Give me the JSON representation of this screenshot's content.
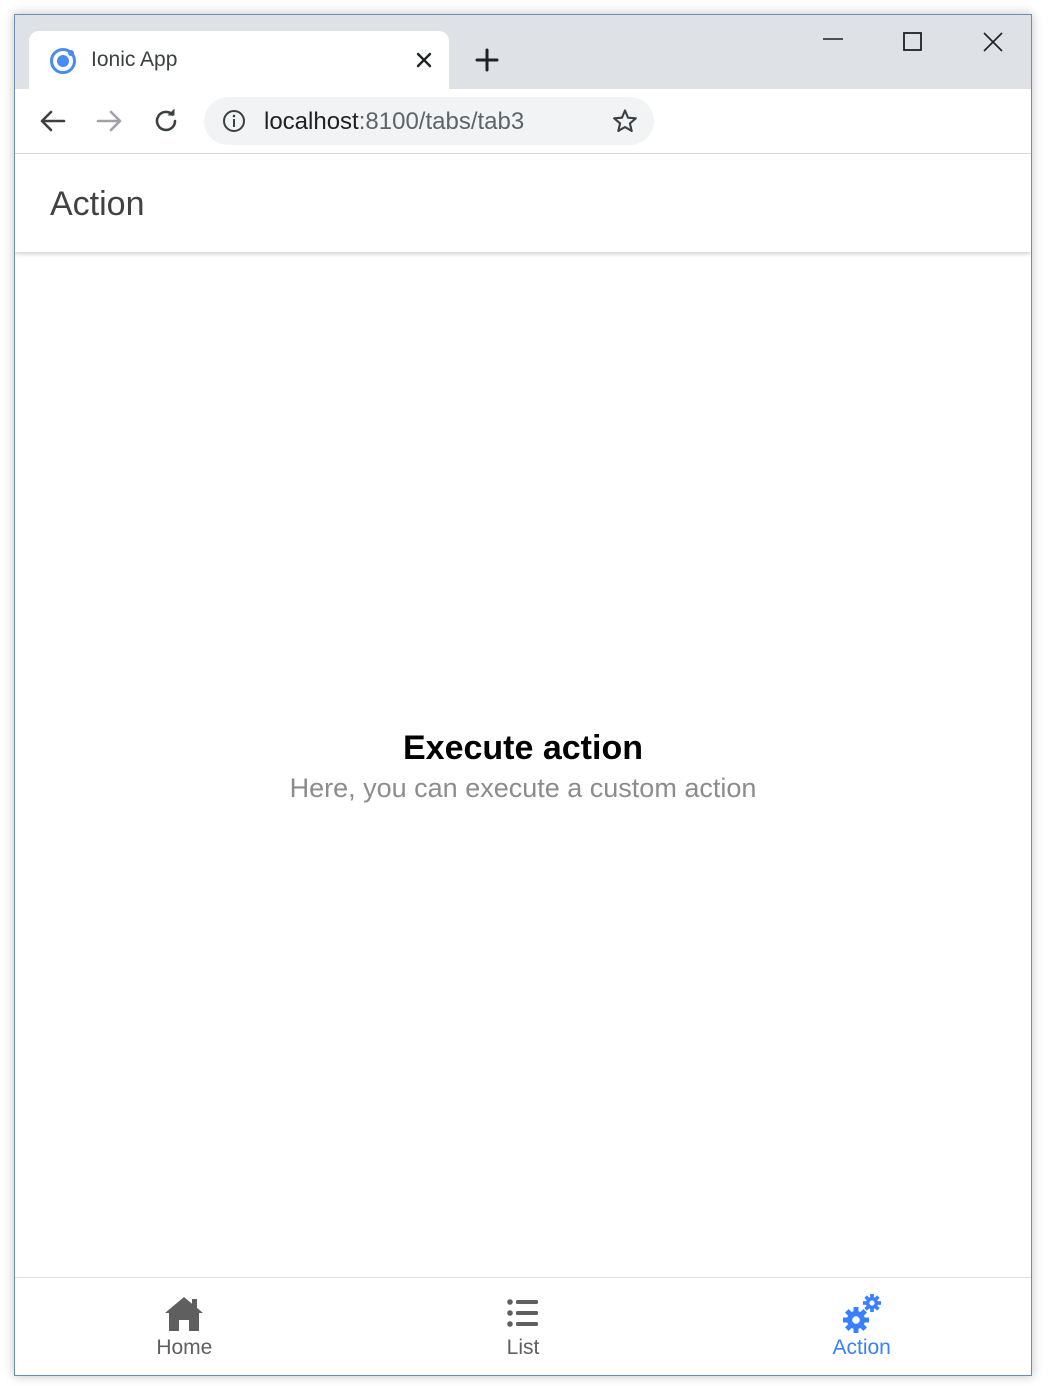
{
  "browser": {
    "tab_title": "Ionic App",
    "url_host": "localhost",
    "url_rest": ":8100/tabs/tab3"
  },
  "app": {
    "header_title": "Action",
    "empty_state": {
      "title": "Execute action",
      "subtitle": "Here, you can execute a custom action"
    },
    "tabs": [
      {
        "label": "Home",
        "icon": "home-icon",
        "active": false
      },
      {
        "label": "List",
        "icon": "list-icon",
        "active": false
      },
      {
        "label": "Action",
        "icon": "cogs-icon",
        "active": true
      }
    ]
  },
  "colors": {
    "accent": "#3880ff",
    "tab_inactive": "#5f5f5f",
    "subtitle": "#8c8c8c"
  }
}
